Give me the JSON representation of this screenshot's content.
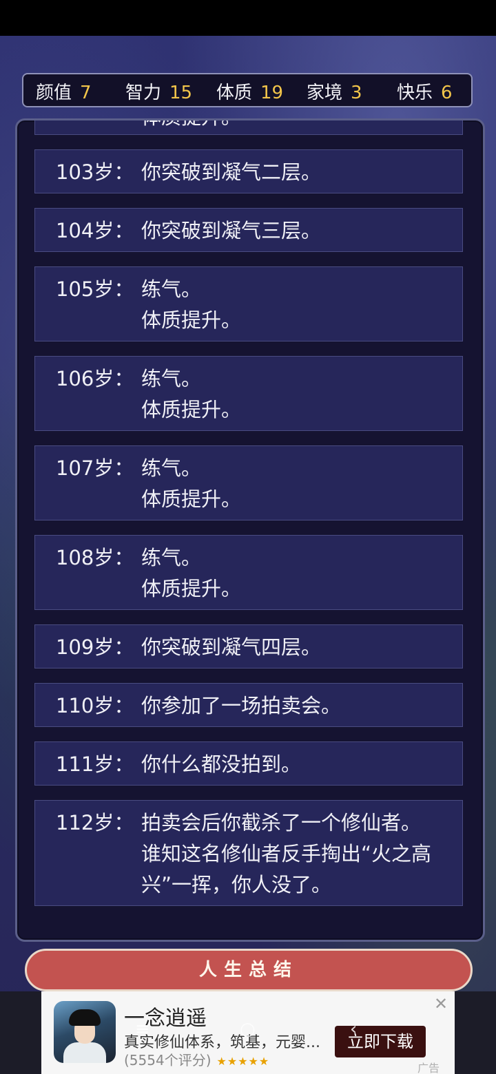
{
  "stats": [
    {
      "label": "颜值",
      "value": "7"
    },
    {
      "label": "智力",
      "value": "15"
    },
    {
      "label": "体质",
      "value": "19"
    },
    {
      "label": "家境",
      "value": "3"
    },
    {
      "label": "快乐",
      "value": "6"
    }
  ],
  "log": {
    "partial_entry": {
      "lines": [
        "体质提升。"
      ]
    },
    "entries": [
      {
        "age": "103岁：",
        "lines": [
          "你突破到凝气二层。"
        ]
      },
      {
        "age": "104岁：",
        "lines": [
          "你突破到凝气三层。"
        ]
      },
      {
        "age": "105岁：",
        "lines": [
          "练气。",
          "体质提升。"
        ]
      },
      {
        "age": "106岁：",
        "lines": [
          "练气。",
          "体质提升。"
        ]
      },
      {
        "age": "107岁：",
        "lines": [
          "练气。",
          "体质提升。"
        ]
      },
      {
        "age": "108岁：",
        "lines": [
          "练气。",
          "体质提升。"
        ]
      },
      {
        "age": "109岁：",
        "lines": [
          "你突破到凝气四层。"
        ]
      },
      {
        "age": "110岁：",
        "lines": [
          "你参加了一场拍卖会。"
        ]
      },
      {
        "age": "111岁：",
        "lines": [
          "你什么都没拍到。"
        ]
      },
      {
        "age": "112岁：",
        "lines": [
          "拍卖会后你截杀了一个修仙者。",
          "谁知这名修仙者反手掏出“火之高",
          "兴”一挥，你人没了。"
        ]
      }
    ]
  },
  "summary_button": {
    "label": "人生总结"
  },
  "ad": {
    "title": "一念逍遥",
    "description": "真实修仙体系，筑基，元婴...",
    "rating": "(5554个评分)",
    "stars": "★★★★★",
    "cta": "立即下载",
    "close": "✕",
    "tag": "广告"
  },
  "nav": {
    "menu": "≡",
    "home": "○",
    "back": "‹"
  }
}
